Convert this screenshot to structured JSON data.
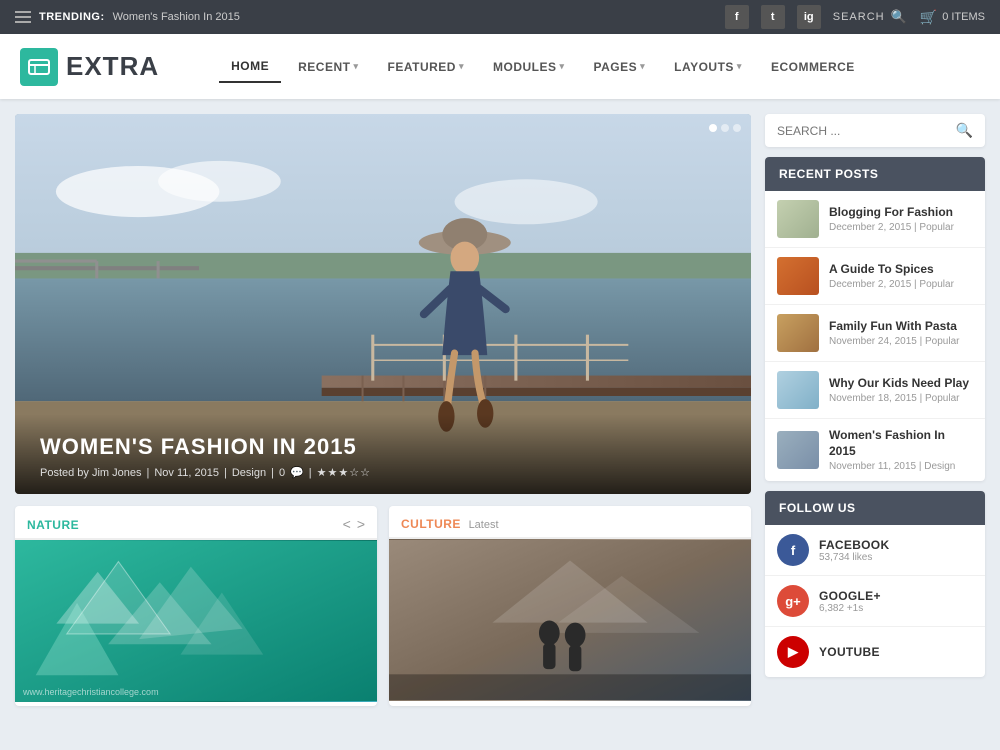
{
  "topbar": {
    "trending_label": "TRENDING:",
    "trending_text": "Women's Fashion In 2015",
    "social": [
      "f",
      "t",
      "ig"
    ],
    "search_label": "SEARCH",
    "cart_label": "0 ITEMS"
  },
  "header": {
    "logo_icon": "E",
    "logo_text": "EXTRA",
    "nav": [
      {
        "label": "HOME",
        "active": true,
        "has_caret": false
      },
      {
        "label": "RECENT",
        "active": false,
        "has_caret": true
      },
      {
        "label": "FEATURED",
        "active": false,
        "has_caret": true
      },
      {
        "label": "MODULES",
        "active": false,
        "has_caret": true
      },
      {
        "label": "PAGES",
        "active": false,
        "has_caret": true
      },
      {
        "label": "LAYOUTS",
        "active": false,
        "has_caret": true
      },
      {
        "label": "ECOMMERCE",
        "active": false,
        "has_caret": false
      }
    ]
  },
  "hero": {
    "title": "WOMEN'S FASHION IN 2015",
    "meta_posted": "Posted by Jim Jones",
    "meta_date": "Nov 11, 2015",
    "meta_category": "Design",
    "meta_comments": "0",
    "stars": "★★★☆☆"
  },
  "nature_card": {
    "category": "NATURE",
    "label": "",
    "watermark": "www.heritagechristiancollege.com"
  },
  "culture_card": {
    "category": "CULTURE",
    "label": "Latest"
  },
  "sidebar": {
    "search_placeholder": "SEARCH ...",
    "recent_posts_header": "RECENT POSTS",
    "posts": [
      {
        "title": "Blogging For Fashion",
        "date": "December 2, 2015",
        "tag": "Popular",
        "thumb": "fashion"
      },
      {
        "title": "A Guide To Spices",
        "date": "December 2, 2015",
        "tag": "Popular",
        "thumb": "spices"
      },
      {
        "title": "Family Fun With Pasta",
        "date": "November 24, 2015",
        "tag": "Popular",
        "thumb": "pasta"
      },
      {
        "title": "Why Our Kids Need Play",
        "date": "November 18, 2015",
        "tag": "Popular",
        "thumb": "kids"
      },
      {
        "title": "Women's Fashion In 2015",
        "date": "November 11, 2015",
        "tag": "Design",
        "thumb": "women"
      }
    ],
    "follow_header": "FOLLOW US",
    "follow": [
      {
        "network": "FACEBOOK",
        "count": "53,734 likes",
        "class": "fb",
        "letter": "f"
      },
      {
        "network": "GOOGLE+",
        "count": "6,382 +1s",
        "class": "gp",
        "letter": "g+"
      },
      {
        "network": "YOUTUBE",
        "count": "",
        "class": "yt",
        "letter": "▶"
      }
    ]
  }
}
